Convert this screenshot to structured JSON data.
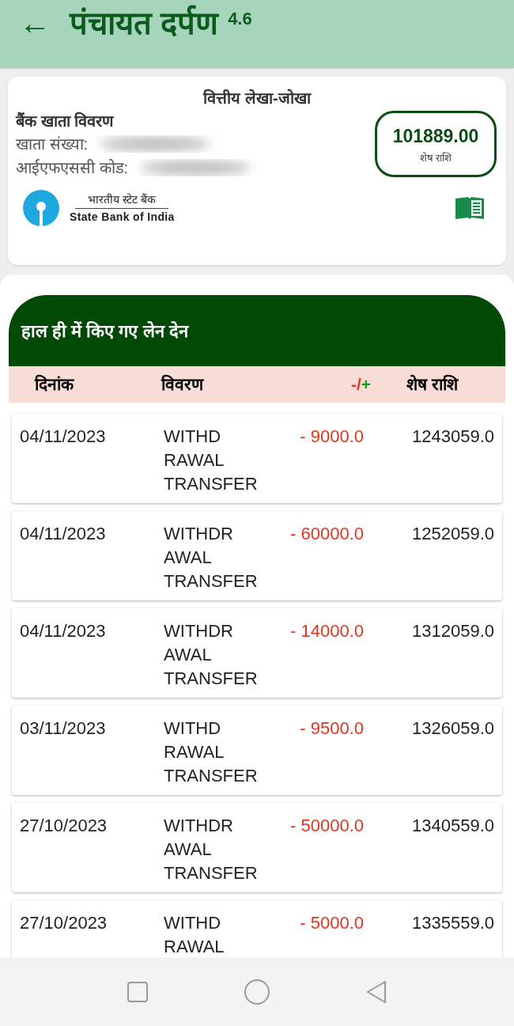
{
  "app_bar": {
    "back_icon": "←",
    "title": "पंचायत दर्पण",
    "version": "4.6"
  },
  "account_card": {
    "title": "वित्तीय लेखा-जोखा",
    "heading": "बैंक खाता विवरण",
    "account_label": "खाता संख्या:",
    "ifsc_label": "आईएफएससी कोड:",
    "balance": "101889.00",
    "balance_label": "शेष राशि",
    "bank_name_hindi": "भारतीय स्टेट बैंक",
    "bank_name": "State Bank of India"
  },
  "transactions": {
    "title": "हाल ही में किए गए लेन देन",
    "columns": [
      "दिनांक",
      "विवरण",
      "-/+",
      "शेष राशि"
    ],
    "rows": [
      {
        "date": "04/11/2023",
        "description": [
          "WITHD",
          "RAWAL",
          "TRANSFER"
        ],
        "amount": "- 9000.0",
        "balance": "1243059.0"
      },
      {
        "date": "04/11/2023",
        "description": [
          "WITHDR",
          "AWAL",
          "TRANSFER"
        ],
        "amount": "- 60000.0",
        "balance": "1252059.0"
      },
      {
        "date": "04/11/2023",
        "description": [
          "WITHDR",
          "AWAL",
          "TRANSFER"
        ],
        "amount": "- 14000.0",
        "balance": "1312059.0"
      },
      {
        "date": "03/11/2023",
        "description": [
          "WITHD",
          "RAWAL",
          "TRANSFER"
        ],
        "amount": "- 9500.0",
        "balance": "1326059.0"
      },
      {
        "date": "27/10/2023",
        "description": [
          "WITHDR",
          "AWAL",
          "TRANSFER"
        ],
        "amount": "- 50000.0",
        "balance": "1340559.0"
      },
      {
        "date": "27/10/2023",
        "description": [
          "WITHD",
          "RAWAL"
        ],
        "amount": "- 5000.0",
        "balance": "1335559.0"
      }
    ]
  }
}
